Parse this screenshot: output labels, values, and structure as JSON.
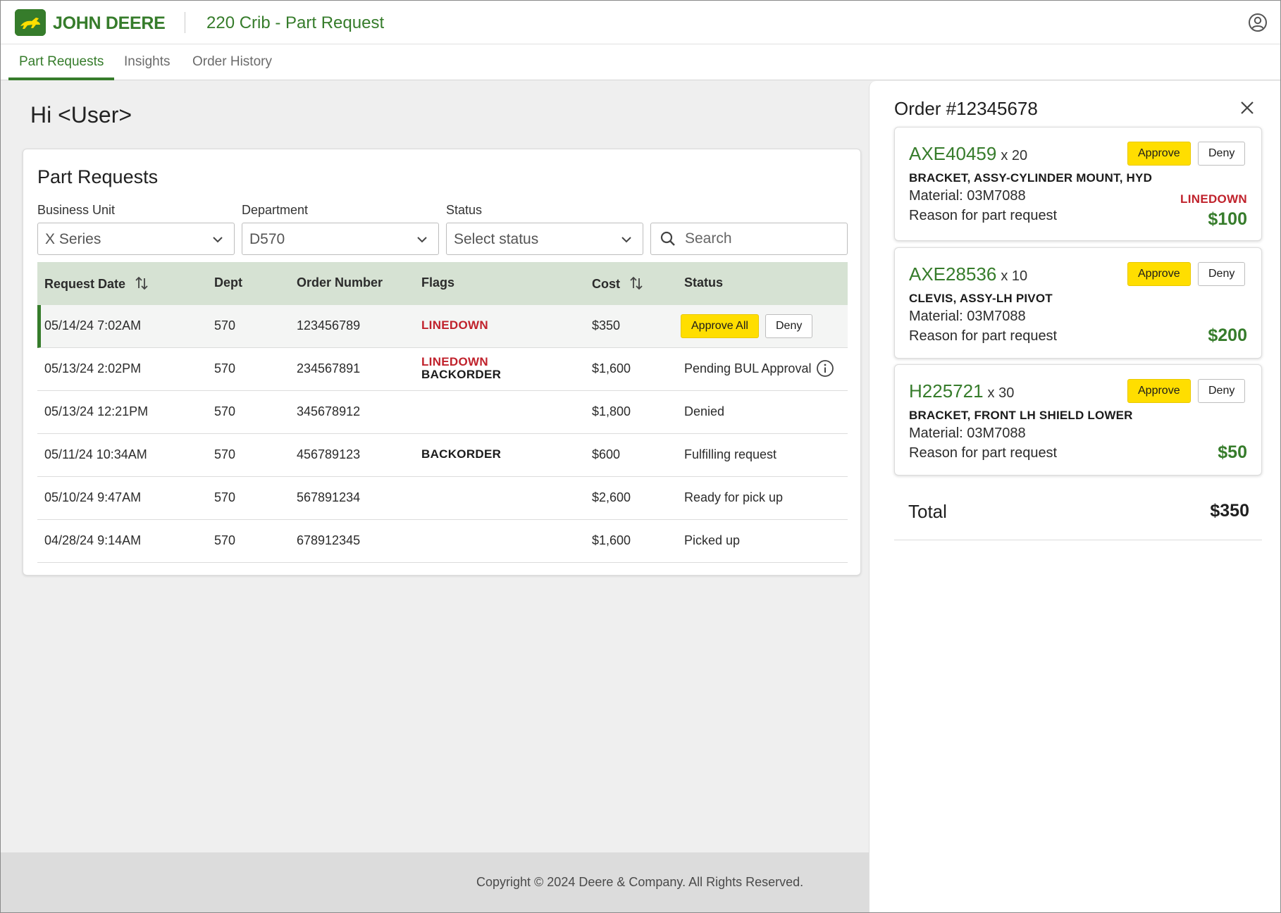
{
  "header": {
    "brand": "JOHN DEERE",
    "app_title": "220 Crib - Part Request",
    "brand_color": "#367c2b"
  },
  "tabs": [
    {
      "label": "Part Requests",
      "active": true
    },
    {
      "label": "Insights",
      "active": false
    },
    {
      "label": "Order History",
      "active": false
    }
  ],
  "greeting": "Hi <User>",
  "part_requests": {
    "title": "Part Requests",
    "filters": {
      "business_unit": {
        "label": "Business Unit",
        "value": "X Series"
      },
      "department": {
        "label": "Department",
        "value": "D570"
      },
      "status": {
        "label": "Status",
        "value": "Select status"
      },
      "search": {
        "placeholder": "Search"
      }
    },
    "columns": [
      "Request Date",
      "Dept",
      "Order Number",
      "Flags",
      "Cost",
      "Status"
    ],
    "rows": [
      {
        "date": "05/14/24 7:02AM",
        "dept": "570",
        "order": "123456789",
        "flag1": "LINEDOWN",
        "flag2": "",
        "cost": "$350",
        "status": "",
        "approve_label": "Approve All",
        "deny_label": "Deny"
      },
      {
        "date": "05/13/24 2:02PM",
        "dept": "570",
        "order": "234567891",
        "flag1": "LINEDOWN",
        "flag2": "BACKORDER",
        "cost": "$1,600",
        "status": "Pending BUL Approval"
      },
      {
        "date": "05/13/24 12:21PM",
        "dept": "570",
        "order": "345678912",
        "flag1": "",
        "flag2": "",
        "cost": "$1,800",
        "status": "Denied"
      },
      {
        "date": "05/11/24 10:34AM",
        "dept": "570",
        "order": "456789123",
        "flag1": "",
        "flag2": "BACKORDER",
        "cost": "$600",
        "status": "Fulfilling request"
      },
      {
        "date": "05/10/24 9:47AM",
        "dept": "570",
        "order": "567891234",
        "flag1": "",
        "flag2": "",
        "cost": "$2,600",
        "status": "Ready for pick up"
      },
      {
        "date": "04/28/24 9:14AM",
        "dept": "570",
        "order": "678912345",
        "flag1": "",
        "flag2": "",
        "cost": "$1,600",
        "status": "Picked up"
      }
    ]
  },
  "footer": {
    "copyright": "Copyright © 2024 Deere & Company. All Rights Reserved."
  },
  "order_panel": {
    "title": "Order #12345678",
    "items": [
      {
        "part": "AXE40459",
        "qty": "x 20",
        "name": "BRACKET, ASSY-CYLINDER MOUNT, HYD",
        "material": "Material: 03M7088",
        "reason": "Reason for part request",
        "flag": "LINEDOWN",
        "price": "$100",
        "approve": "Approve",
        "deny": "Deny"
      },
      {
        "part": "AXE28536",
        "qty": "x 10",
        "name": "CLEVIS, ASSY-LH PIVOT",
        "material": "Material: 03M7088",
        "reason": "Reason for part request",
        "flag": "",
        "price": "$200",
        "approve": "Approve",
        "deny": "Deny"
      },
      {
        "part": "H225721",
        "qty": "x 30",
        "name": "BRACKET, FRONT LH SHIELD LOWER",
        "material": "Material: 03M7088",
        "reason": "Reason for part request",
        "flag": "",
        "price": "$50",
        "approve": "Approve",
        "deny": "Deny"
      }
    ],
    "total_label": "Total",
    "total_value": "$350"
  }
}
